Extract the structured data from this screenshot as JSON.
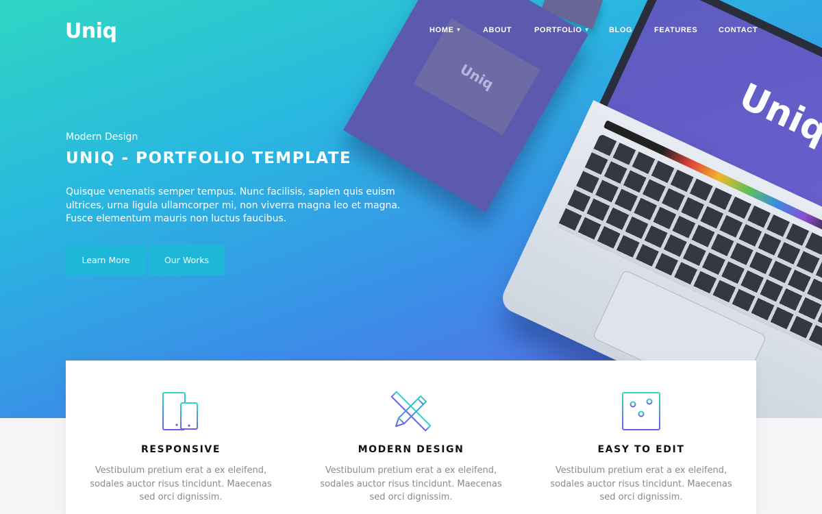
{
  "brand": {
    "name": "Uniq"
  },
  "nav": {
    "items": [
      {
        "label": "HOME",
        "has_dropdown": true
      },
      {
        "label": "ABOUT",
        "has_dropdown": false
      },
      {
        "label": "PORTFOLIO",
        "has_dropdown": true
      },
      {
        "label": "BLOG",
        "has_dropdown": false
      },
      {
        "label": "FEATURES",
        "has_dropdown": false
      },
      {
        "label": "CONTACT",
        "has_dropdown": false
      }
    ]
  },
  "hero": {
    "subtitle": "Modern Design",
    "title": "UNIQ - PORTFOLIO TEMPLATE",
    "text": "Quisque venenatis semper tempus. Nunc facilisis, sapien quis euism ultrices, urna ligula ullamcorper mi, non viverra magna leo et magna. Fusce elementum mauris non luctus faucibus.",
    "buttons": {
      "learn_more": "Learn More",
      "our_works": "Our Works"
    },
    "mockup_logo": "Uniq"
  },
  "features": [
    {
      "icon": "devices-icon",
      "title": "RESPONSIVE",
      "text": "Vestibulum pretium erat a ex eleifend, sodales auctor risus tincidunt. Maecenas sed orci dignissim."
    },
    {
      "icon": "pencil-ruler-icon",
      "title": "MODERN DESIGN",
      "text": "Vestibulum pretium erat a ex eleifend, sodales auctor risus tincidunt. Maecenas sed orci dignissim."
    },
    {
      "icon": "sliders-icon",
      "title": "EASY TO EDIT",
      "text": "Vestibulum pretium erat a ex eleifend, sodales auctor risus tincidunt. Maecenas sed orci dignissim."
    }
  ],
  "colors": {
    "accent": "#1fb7d8",
    "gradient_start": "#2fd6c3",
    "gradient_end": "#6a5ee8",
    "heading": "#111111",
    "muted_text": "#8a8a8a"
  }
}
